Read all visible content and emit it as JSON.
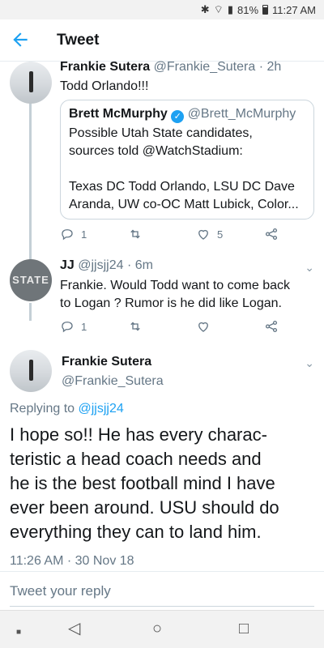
{
  "status": {
    "battery": "81%",
    "time": "11:27 AM"
  },
  "header": {
    "title": "Tweet"
  },
  "tweets": [
    {
      "name": "Frankie Sutera",
      "handle": "@Frankie_Sutera",
      "age": "· 2h",
      "text": "Todd Orlando!!!",
      "quote": {
        "name": "Brett McMurphy",
        "handle": "@Brett_McMurphy",
        "line1": "Possible Utah State candidates,",
        "line2": "sources told @WatchStadium:",
        "line3": "Texas DC Todd Orlando, LSU DC Dave",
        "line4": "Aranda, UW co-OC Matt Lubick, Color..."
      },
      "replies": "1",
      "likes": "5"
    },
    {
      "name": "JJ",
      "handle": "@jjsjj24",
      "age": "· 6m",
      "avatar_text": "STATE",
      "line1": "Frankie. Would Todd want to come back",
      "line2": "to Logan ? Rumor is he did like Logan.",
      "replies": "1"
    }
  ],
  "main": {
    "name": "Frankie Sutera",
    "handle": "@Frankie_Sutera",
    "replying_prefix": "Replying to",
    "replying_to": "@jjsjj24",
    "lines": [
      "I hope so!! He has every charac-",
      "teristic a head coach needs and",
      "he is the best football mind I have",
      "ever been around. USU should do",
      "everything they can to land him."
    ],
    "timestamp": "11:26 AM · 30 Nov 18"
  },
  "reply_placeholder": "Tweet your reply",
  "colors": {
    "accent": "#1da1f2",
    "muted": "#657786",
    "border": "#e6ecf0"
  }
}
